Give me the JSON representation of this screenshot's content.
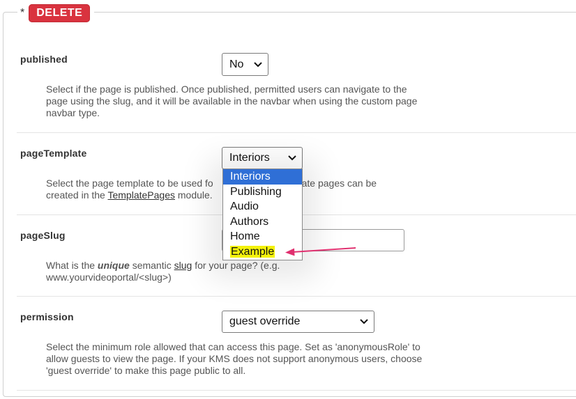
{
  "legend": {
    "asterisk": "*",
    "delete_label": "DELETE"
  },
  "fields": {
    "published": {
      "label": "published",
      "value": "No",
      "help": "Select if the page is published. Once published, permitted users can navigate to the page using the slug, and it will be available in the navbar when using the custom page navbar type."
    },
    "pageTemplate": {
      "label": "pageTemplate",
      "value": "Interiors",
      "help_pre": "Select the page template to be used fo",
      "help_mid1": "plate pages can be",
      "help_line2_pre": "created in the ",
      "help_link": "TemplatePages",
      "help_line2_post": " module."
    },
    "pageSlug": {
      "label": "pageSlug",
      "help_pre": "What is the ",
      "help_em": "unique",
      "help_mid": " semantic ",
      "help_link": "slug",
      "help_post": " for your page? (e.g.",
      "help_line2": "www.yourvideoportal/<slug>)"
    },
    "permission": {
      "label": "permission",
      "value": "guest override",
      "help": "Select the minimum role allowed that can access this page. Set as 'anonymousRole' to allow guests to view the page. If your KMS does not support anonymous users, choose 'guest override' to make this page public to all."
    }
  },
  "dropdown": {
    "options": [
      "Interiors",
      "Publishing",
      "Audio",
      "Authors",
      "Home",
      "Example"
    ],
    "selected": "Interiors",
    "highlighted": "Example"
  },
  "colors": {
    "delete_bg": "#d9333f",
    "selected_option_bg": "#2f6fd6",
    "highlight": "#f4f20a",
    "annotation_arrow": "#e0306f"
  }
}
